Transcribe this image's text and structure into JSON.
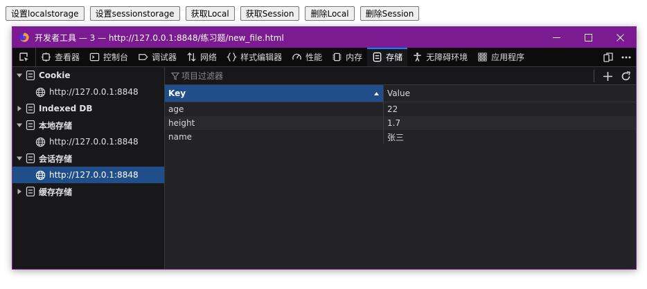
{
  "page_buttons": [
    {
      "label": "设置localstorage"
    },
    {
      "label": "设置sessionstorage"
    },
    {
      "label": "获取Local"
    },
    {
      "label": "获取Session"
    },
    {
      "label": "删除Local"
    },
    {
      "label": "删除Session"
    }
  ],
  "devtools": {
    "window_title": "开发者工具 — 3 — http://127.0.0.1:8848/练习题/new_file.html",
    "titlebar_color": "#7b1a91",
    "tabs": [
      {
        "label": "查看器",
        "icon": "inspector-icon"
      },
      {
        "label": "控制台",
        "icon": "console-icon"
      },
      {
        "label": "调试器",
        "icon": "debugger-icon"
      },
      {
        "label": "网络",
        "icon": "network-icon"
      },
      {
        "label": "样式编辑器",
        "icon": "style-editor-icon"
      },
      {
        "label": "性能",
        "icon": "performance-icon"
      },
      {
        "label": "内存",
        "icon": "memory-icon"
      },
      {
        "label": "存储",
        "icon": "storage-icon",
        "active": true
      },
      {
        "label": "无障碍环境",
        "icon": "accessibility-icon"
      },
      {
        "label": "应用程序",
        "icon": "application-icon"
      }
    ],
    "sidebar": {
      "cookie": {
        "label": "Cookie",
        "host": "http://127.0.0.1:8848"
      },
      "indexeddb": {
        "label": "Indexed DB"
      },
      "local_storage": {
        "label": "本地存储",
        "host": "http://127.0.0.1:8848"
      },
      "session_storage": {
        "label": "会话存储",
        "host": "http://127.0.0.1:8848",
        "selected": true
      },
      "cache_storage": {
        "label": "缓存存储"
      }
    },
    "filter": {
      "placeholder": "项目过滤器"
    },
    "table": {
      "columns": {
        "key": "Key",
        "value": "Value"
      },
      "sort": "key-ascending",
      "rows": [
        {
          "key": "age",
          "value": "22"
        },
        {
          "key": "height",
          "value": "1.7"
        },
        {
          "key": "name",
          "value": "张三"
        }
      ]
    },
    "accent_color": "#0a84ff",
    "selection_color": "#204e8a"
  }
}
